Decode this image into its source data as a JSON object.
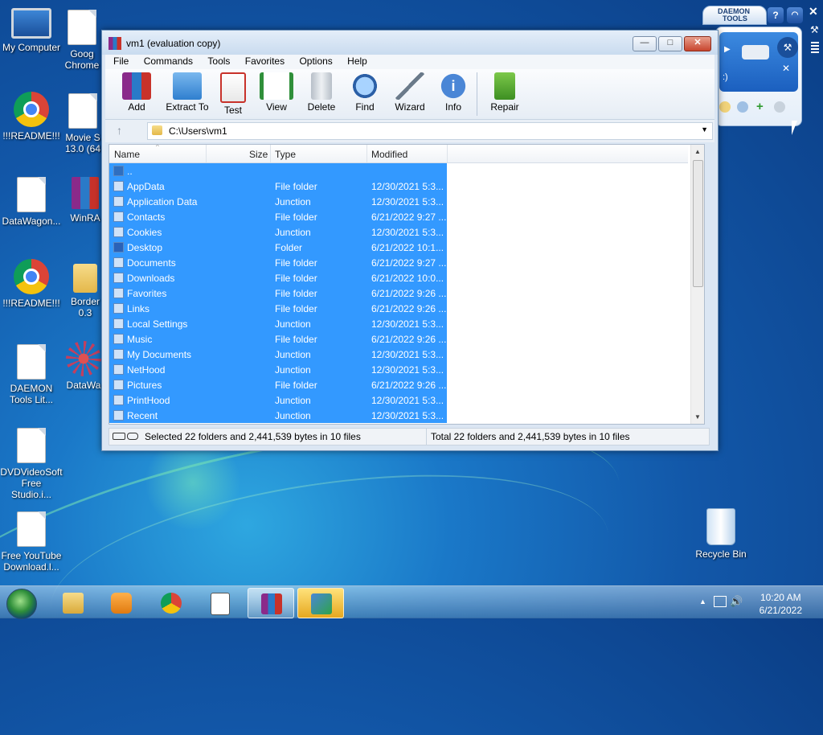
{
  "desktop": {
    "icons": [
      {
        "label": "My Computer"
      },
      {
        "label": "Goog Chrome"
      },
      {
        "label": "!!!README!!!"
      },
      {
        "label": "Movie S 13.0 (64"
      },
      {
        "label": "DataWagon..."
      },
      {
        "label": "WinRA"
      },
      {
        "label": "!!!README!!!"
      },
      {
        "label": "Border 0.3"
      },
      {
        "label": "DAEMON Tools Lit..."
      },
      {
        "label": "DataWa"
      },
      {
        "label": "DVDVideoSoft Free Studio.i..."
      },
      {
        "label": "Free YouTube Download.l..."
      },
      {
        "label": "Recycle Bin"
      }
    ]
  },
  "window": {
    "title": "vm1 (evaluation copy)",
    "controls": {
      "minimize": "—",
      "maximize": "□",
      "close": "✕"
    },
    "menu": [
      "File",
      "Commands",
      "Tools",
      "Favorites",
      "Options",
      "Help"
    ],
    "toolbar": [
      {
        "label": "Add",
        "icon": "add-icon"
      },
      {
        "label": "Extract To",
        "icon": "extract-icon"
      },
      {
        "label": "Test",
        "icon": "test-icon"
      },
      {
        "label": "View",
        "icon": "view-icon"
      },
      {
        "label": "Delete",
        "icon": "delete-icon"
      },
      {
        "label": "Find",
        "icon": "find-icon"
      },
      {
        "label": "Wizard",
        "icon": "wizard-icon"
      },
      {
        "label": "Info",
        "icon": "info-icon"
      },
      {
        "label": "Repair",
        "icon": "repair-icon"
      }
    ],
    "address": {
      "path": "C:\\Users\\vm1"
    },
    "columns": [
      "Name",
      "Size",
      "Type",
      "Modified"
    ],
    "rows": [
      {
        "name": "..",
        "type": "",
        "modified": ""
      },
      {
        "name": "AppData",
        "type": "File folder",
        "modified": "12/30/2021 5:3..."
      },
      {
        "name": "Application Data",
        "type": "Junction",
        "modified": "12/30/2021 5:3..."
      },
      {
        "name": "Contacts",
        "type": "File folder",
        "modified": "6/21/2022 9:27 ..."
      },
      {
        "name": "Cookies",
        "type": "Junction",
        "modified": "12/30/2021 5:3..."
      },
      {
        "name": "Desktop",
        "type": "Folder",
        "modified": "6/21/2022 10:1..."
      },
      {
        "name": "Documents",
        "type": "File folder",
        "modified": "6/21/2022 9:27 ..."
      },
      {
        "name": "Downloads",
        "type": "File folder",
        "modified": "6/21/2022 10:0..."
      },
      {
        "name": "Favorites",
        "type": "File folder",
        "modified": "6/21/2022 9:26 ..."
      },
      {
        "name": "Links",
        "type": "File folder",
        "modified": "6/21/2022 9:26 ..."
      },
      {
        "name": "Local Settings",
        "type": "Junction",
        "modified": "12/30/2021 5:3..."
      },
      {
        "name": "Music",
        "type": "File folder",
        "modified": "6/21/2022 9:26 ..."
      },
      {
        "name": "My Documents",
        "type": "Junction",
        "modified": "12/30/2021 5:3..."
      },
      {
        "name": "NetHood",
        "type": "Junction",
        "modified": "12/30/2021 5:3..."
      },
      {
        "name": "Pictures",
        "type": "File folder",
        "modified": "6/21/2022 9:26 ..."
      },
      {
        "name": "PrintHood",
        "type": "Junction",
        "modified": "12/30/2021 5:3..."
      },
      {
        "name": "Recent",
        "type": "Junction",
        "modified": "12/30/2021 5:3..."
      }
    ],
    "status": {
      "selected": "Selected 22 folders and 2,441,539 bytes in 10 files",
      "total": "Total 22 folders and 2,441,539 bytes in 10 files"
    }
  },
  "daemon": {
    "brand_line1": "DAEMON",
    "brand_line2": "TOOLS",
    "help": "?",
    "drive_text": ":)"
  },
  "taskbar": {
    "time": "10:20 AM",
    "date": "6/21/2022"
  }
}
